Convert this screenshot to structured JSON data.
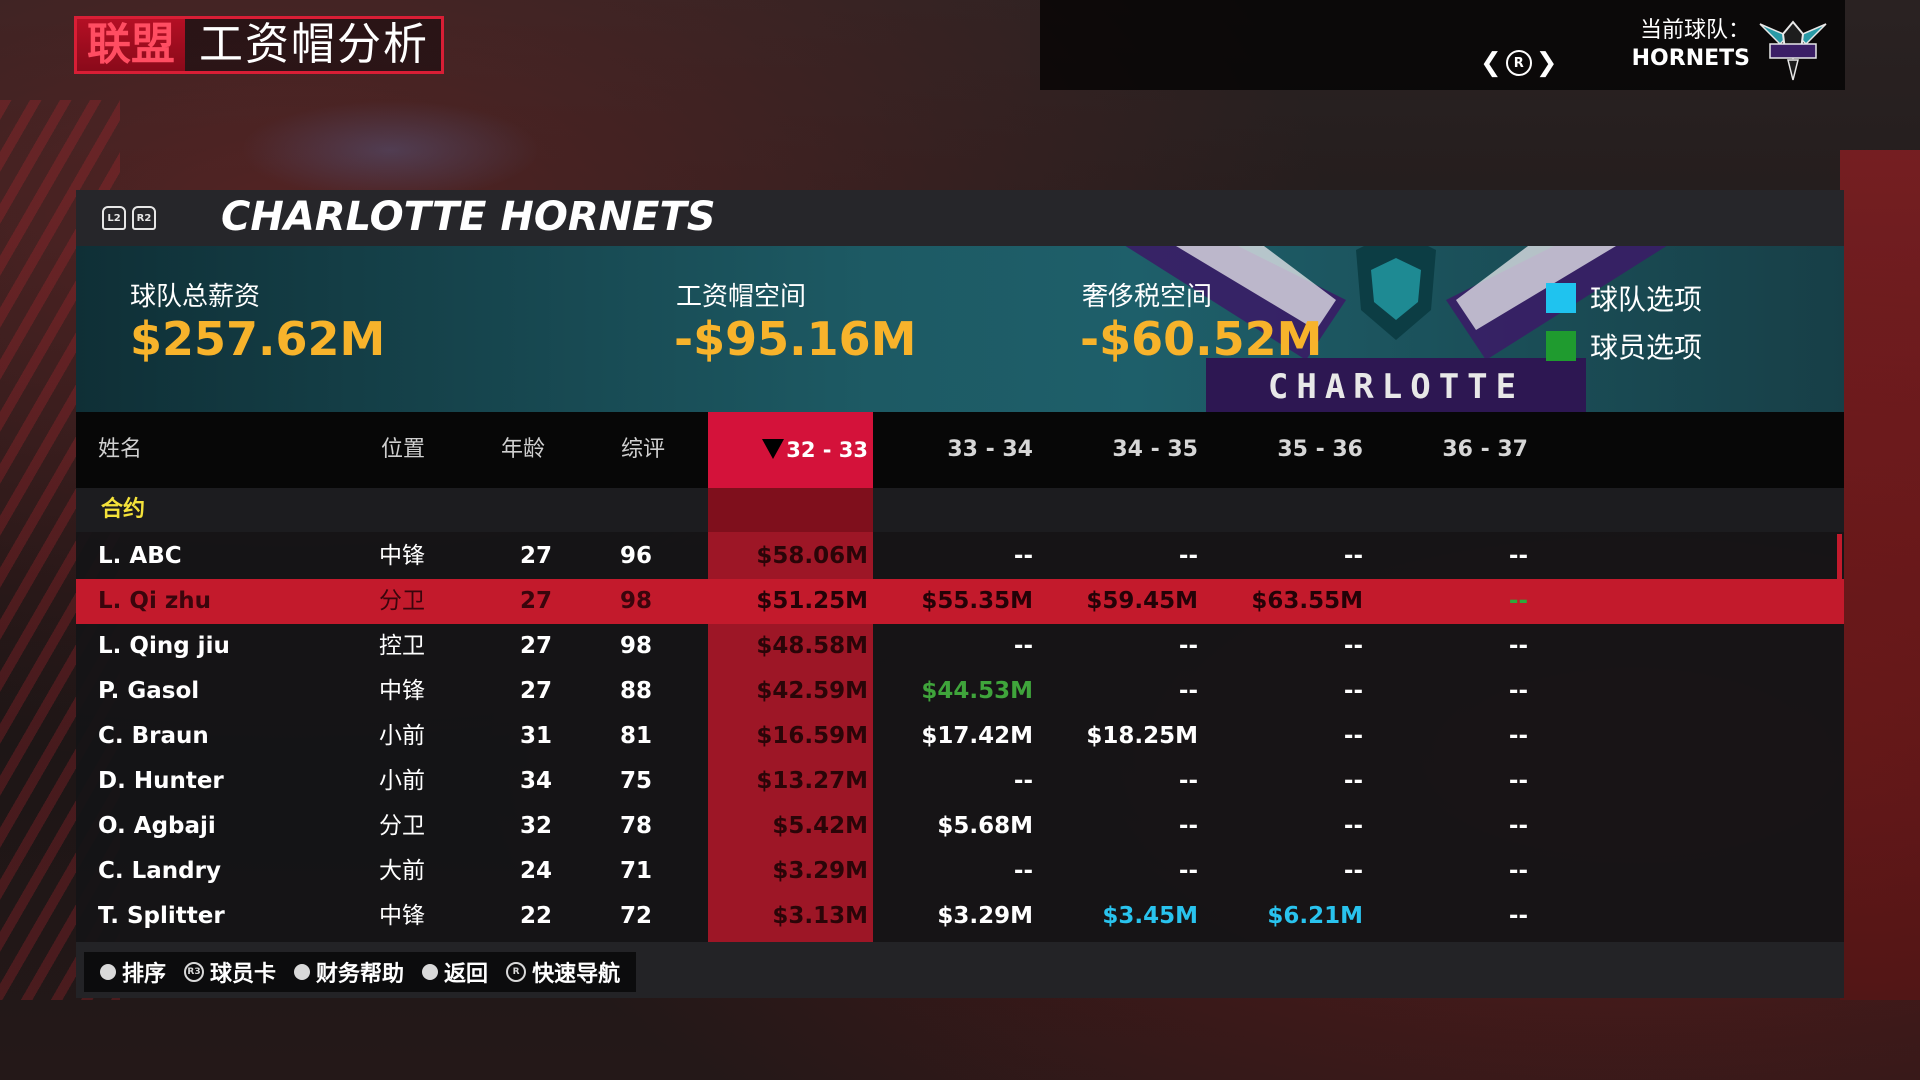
{
  "header": {
    "title_red": "联盟",
    "title_white": "工资帽分析",
    "current_team_label": "当前球队：",
    "current_team": "HORNETS",
    "switch_button": "R"
  },
  "panel": {
    "triggers": [
      "L2",
      "R2"
    ],
    "team_name": "CHARLOTTE HORNETS"
  },
  "summary": {
    "total_salary_label": "球队总薪资",
    "total_salary": "$257.62M",
    "cap_space_label": "工资帽空间",
    "cap_space": "-$95.16M",
    "tax_space_label": "奢侈税空间",
    "tax_space": "-$60.52M",
    "logo_text": "CHARLOTTE",
    "legend": [
      {
        "label": "球队选项",
        "color": "#1fc3ef"
      },
      {
        "label": "球员选项",
        "color": "#1f9b2f"
      }
    ]
  },
  "table": {
    "headers": {
      "name": "姓名",
      "position": "位置",
      "age": "年龄",
      "overall": "综评",
      "seasons": [
        "32 - 33",
        "33 - 34",
        "34 - 35",
        "35 - 36",
        "36 - 37"
      ]
    },
    "section_label": "合约",
    "rows": [
      {
        "name": "L. ABC",
        "pos": "中锋",
        "age": "27",
        "ovr": "96",
        "s": [
          "$58.06M",
          "--",
          "--",
          "--",
          "--"
        ],
        "t": [
          "",
          "",
          "",
          "",
          ""
        ]
      },
      {
        "name": "L. Qi zhu",
        "pos": "分卫",
        "age": "27",
        "ovr": "98",
        "s": [
          "$51.25M",
          "$55.35M",
          "$59.45M",
          "$63.55M",
          "--"
        ],
        "t": [
          "",
          "",
          "",
          "",
          "green"
        ]
      },
      {
        "name": "L. Qing jiu",
        "pos": "控卫",
        "age": "27",
        "ovr": "98",
        "s": [
          "$48.58M",
          "--",
          "--",
          "--",
          "--"
        ],
        "t": [
          "",
          "",
          "",
          "",
          ""
        ]
      },
      {
        "name": "P. Gasol",
        "pos": "中锋",
        "age": "27",
        "ovr": "88",
        "s": [
          "$42.59M",
          "$44.53M",
          "--",
          "--",
          "--"
        ],
        "t": [
          "",
          "green",
          "",
          "",
          ""
        ]
      },
      {
        "name": "C. Braun",
        "pos": "小前",
        "age": "31",
        "ovr": "81",
        "s": [
          "$16.59M",
          "$17.42M",
          "$18.25M",
          "--",
          "--"
        ],
        "t": [
          "",
          "",
          "",
          "",
          ""
        ]
      },
      {
        "name": "D. Hunter",
        "pos": "小前",
        "age": "34",
        "ovr": "75",
        "s": [
          "$13.27M",
          "--",
          "--",
          "--",
          "--"
        ],
        "t": [
          "",
          "",
          "",
          "",
          ""
        ]
      },
      {
        "name": "O. Agbaji",
        "pos": "分卫",
        "age": "32",
        "ovr": "78",
        "s": [
          "$5.42M",
          "$5.68M",
          "--",
          "--",
          "--"
        ],
        "t": [
          "",
          "",
          "",
          "",
          ""
        ]
      },
      {
        "name": "C. Landry",
        "pos": "大前",
        "age": "24",
        "ovr": "71",
        "s": [
          "$3.29M",
          "--",
          "--",
          "--",
          "--"
        ],
        "t": [
          "",
          "",
          "",
          "",
          ""
        ]
      },
      {
        "name": "T. Splitter",
        "pos": "中锋",
        "age": "22",
        "ovr": "72",
        "s": [
          "$3.13M",
          "$3.29M",
          "$3.45M",
          "$6.21M",
          "--"
        ],
        "t": [
          "",
          "",
          "cyan",
          "cyan",
          ""
        ]
      }
    ],
    "selected_index": 1
  },
  "controls": [
    {
      "icon": "",
      "label": "排序"
    },
    {
      "icon": "R3",
      "label": "球员卡"
    },
    {
      "icon": "",
      "label": "财务帮助"
    },
    {
      "icon": "",
      "label": "返回"
    },
    {
      "icon": "R",
      "label": "快速导航"
    }
  ]
}
